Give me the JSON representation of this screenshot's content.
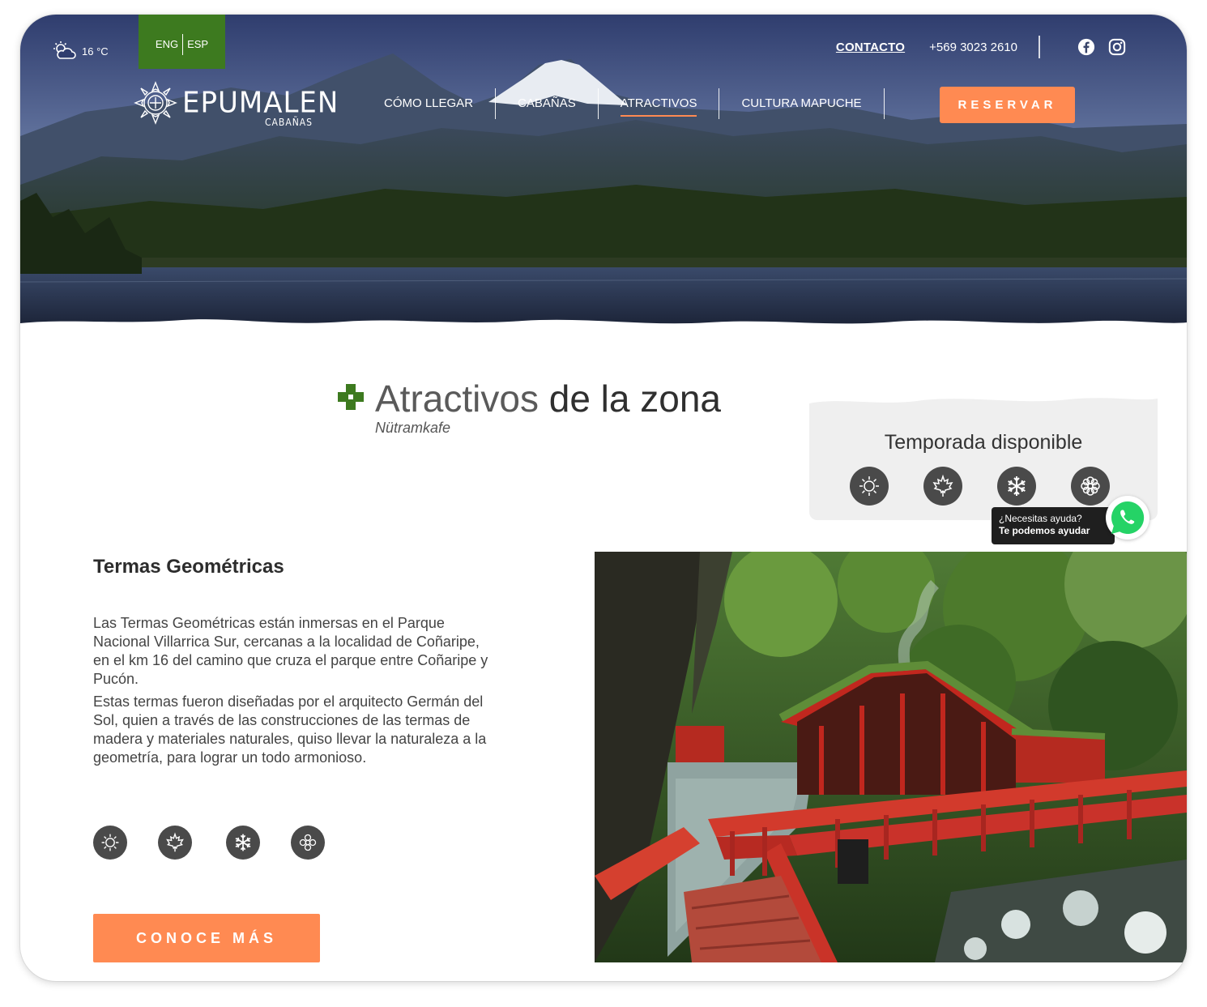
{
  "weather": {
    "temperature": "16 °C",
    "icon": "partly-cloudy-icon"
  },
  "language": {
    "eng": "ENG",
    "esp": "ESP"
  },
  "topbar": {
    "contact": "CONTACTO",
    "phone": "+569 3023 2610",
    "social": [
      "facebook-icon",
      "instagram-icon"
    ]
  },
  "logo": {
    "name": "EPUMALEN",
    "sub": "CABAÑAS"
  },
  "nav": {
    "items": [
      {
        "label": "CÓMO LLEGAR",
        "active": false
      },
      {
        "label": "CABAÑAS",
        "active": false
      },
      {
        "label": "ATRACTIVOS",
        "active": true
      },
      {
        "label": "CULTURA MAPUCHE",
        "active": false
      }
    ],
    "reserve": "RESERVAR"
  },
  "section": {
    "title_a": "Atractivos",
    "title_b": "de la zona",
    "subtitle": "Nütramkafe"
  },
  "season": {
    "label": "Temporada disponible",
    "icons": [
      "summer-sun-icon",
      "autumn-leaf-icon",
      "winter-snowflake-icon",
      "spring-flower-icon"
    ]
  },
  "help": {
    "line1": "¿Necesitas ayuda?",
    "line2": "Te podemos ayudar",
    "icon": "whatsapp-icon"
  },
  "attraction": {
    "title": "Termas Geométricas",
    "paragraphs": [
      "Las Termas Geométricas están inmersas en el Parque Nacional Villarrica Sur, cercanas a la localidad de Coñaripe, en el km 16 del camino que cruza el parque entre Coñaripe y Pucón.",
      "Estas termas fueron diseñadas por el arquitecto Germán del Sol, quien a través de las construcciones de las termas de madera y materiales naturales, quiso llevar la naturaleza a la geometría, para lograr un todo armonioso."
    ],
    "seasons": [
      "summer-sun-icon",
      "autumn-leaf-icon",
      "winter-snowflake-icon",
      "spring-flower-icon"
    ],
    "cta": "CONOCE MÁS"
  },
  "colors": {
    "accent": "#ff8a52",
    "green": "#3d7a1f",
    "icon_bg": "#4a4a4a"
  }
}
